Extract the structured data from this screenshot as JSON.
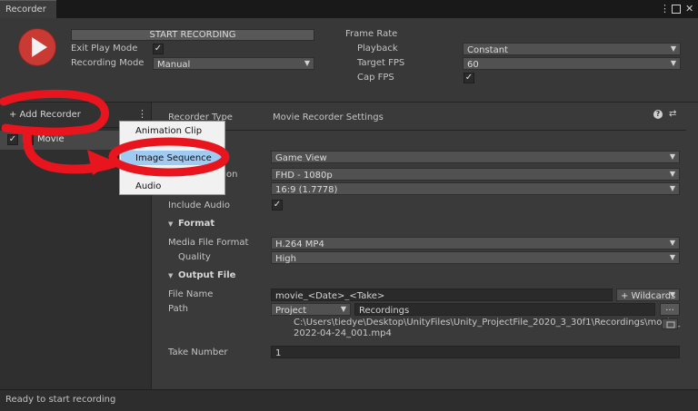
{
  "window": {
    "tab_title": "Recorder",
    "menu_icon": "kebab-icon",
    "maximize_icon": "maximize-icon",
    "close_icon": "close-icon"
  },
  "top": {
    "start_button": "START RECORDING",
    "exit_play_mode_label": "Exit Play Mode",
    "exit_play_mode_checked": true,
    "recording_mode_label": "Recording Mode",
    "recording_mode_value": "Manual",
    "frame_rate_label": "Frame Rate",
    "playback_label": "Playback",
    "playback_value": "Constant",
    "target_fps_label": "Target FPS",
    "target_fps_value": "60",
    "cap_fps_label": "Cap FPS",
    "cap_fps_checked": true
  },
  "left": {
    "add_recorder": "+ Add Recorder",
    "recorder_item": "Movie",
    "recorder_item_checked": true
  },
  "popup": {
    "items": [
      "Animation Clip",
      "Image Sequence",
      "Audio"
    ],
    "highlighted": "Image Sequence"
  },
  "right": {
    "recorder_type_label": "Recorder Type",
    "recorder_type_value": "Movie Recorder Settings",
    "help_icon": "help-icon",
    "preset_icon": "preset-icon",
    "source_value": "Game View",
    "resolution_label_partial": "ution",
    "resolution_value": "FHD - 1080p",
    "aspect_value": "16:9 (1.7778)",
    "include_audio_label": "Include Audio",
    "include_audio_checked": true,
    "format_header": "Format",
    "media_file_format_label": "Media File Format",
    "media_file_format_value": "H.264 MP4",
    "quality_label": "Quality",
    "quality_value": "High",
    "output_file_header": "Output File",
    "file_name_label": "File Name",
    "file_name_value": "movie_<Date>_<Take>",
    "wildcards_button": "+ Wildcards",
    "path_label": "Path",
    "path_root_value": "Project",
    "path_value": "Recordings",
    "browse_button": "...",
    "full_path_line1": "C:\\Users\\tiedye\\Desktop\\UnityFiles\\Unity_ProjectFile_2020_3_30f1\\Recordings\\movie_",
    "full_path_line2": "2022-04-24_001.mp4",
    "take_number_label": "Take Number",
    "take_number_value": "1"
  },
  "status": {
    "text": "Ready to start recording"
  },
  "annotation": {
    "color": "#e8141e"
  }
}
